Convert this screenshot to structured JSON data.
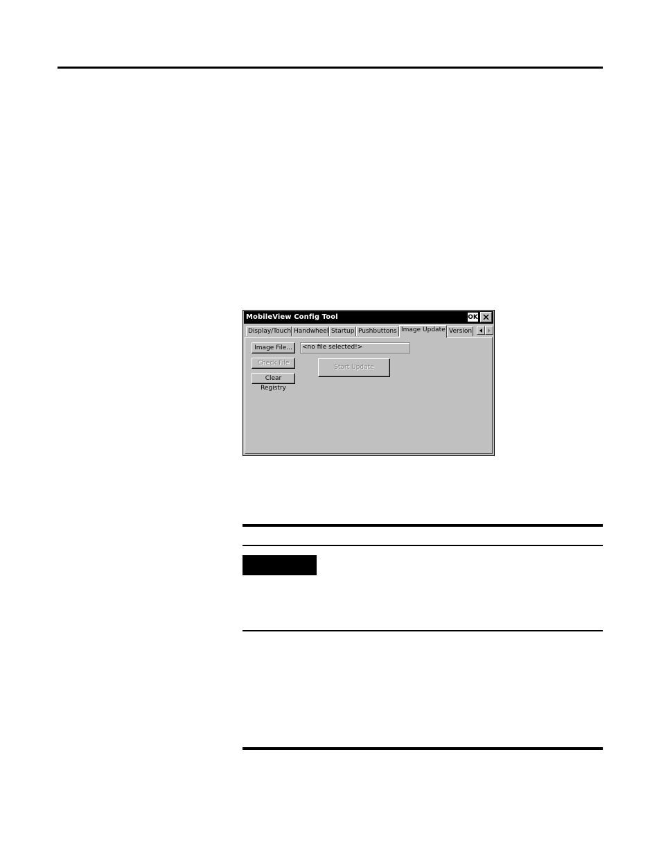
{
  "window": {
    "title": "MobileView Config Tool",
    "ok_label": "OK"
  },
  "tabs": [
    {
      "label": "Display/Touch",
      "active": false
    },
    {
      "label": "Handwheel",
      "active": false
    },
    {
      "label": "Startup",
      "active": false
    },
    {
      "label": "Pushbuttons",
      "active": false
    },
    {
      "label": "Image Update",
      "active": true
    },
    {
      "label": "Version",
      "active": false
    }
  ],
  "image_update": {
    "image_file_label": "Image File...",
    "file_value": "<no file selected!>",
    "check_file_label": "Check File",
    "clear_registry_label": "Clear Registry",
    "start_update_label": "Start Update"
  }
}
